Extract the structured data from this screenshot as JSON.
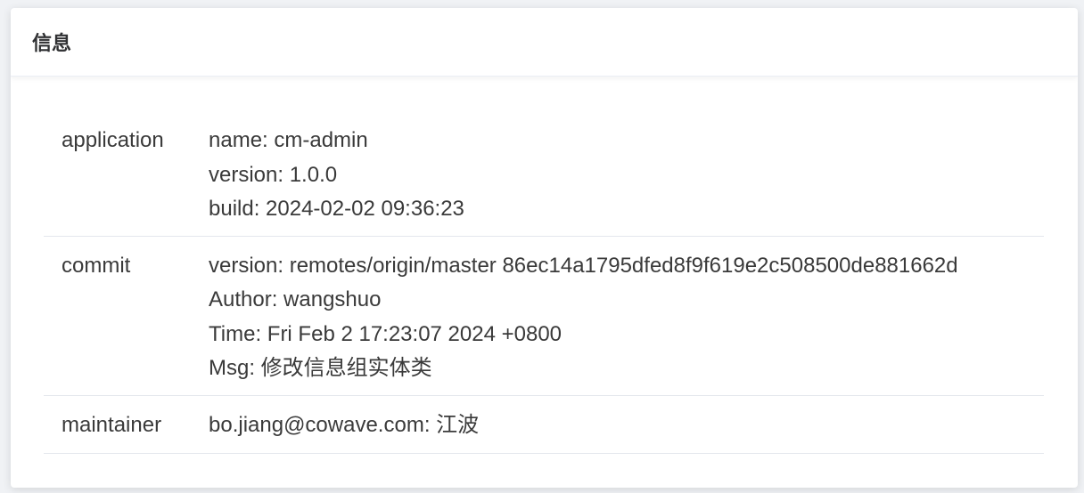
{
  "card": {
    "title": "信息"
  },
  "rows": [
    {
      "label": "application",
      "lines": [
        "name: cm-admin",
        "version: 1.0.0",
        "build: 2024-02-02 09:36:23"
      ]
    },
    {
      "label": "commit",
      "lines": [
        "version: remotes/origin/master 86ec14a1795dfed8f9f619e2c508500de881662d",
        "Author: wangshuo",
        "Time: Fri Feb 2 17:23:07 2024 +0800",
        "Msg: 修改信息组实体类"
      ]
    },
    {
      "label": "maintainer",
      "lines": [
        "bo.jiang@cowave.com: 江波"
      ]
    }
  ]
}
